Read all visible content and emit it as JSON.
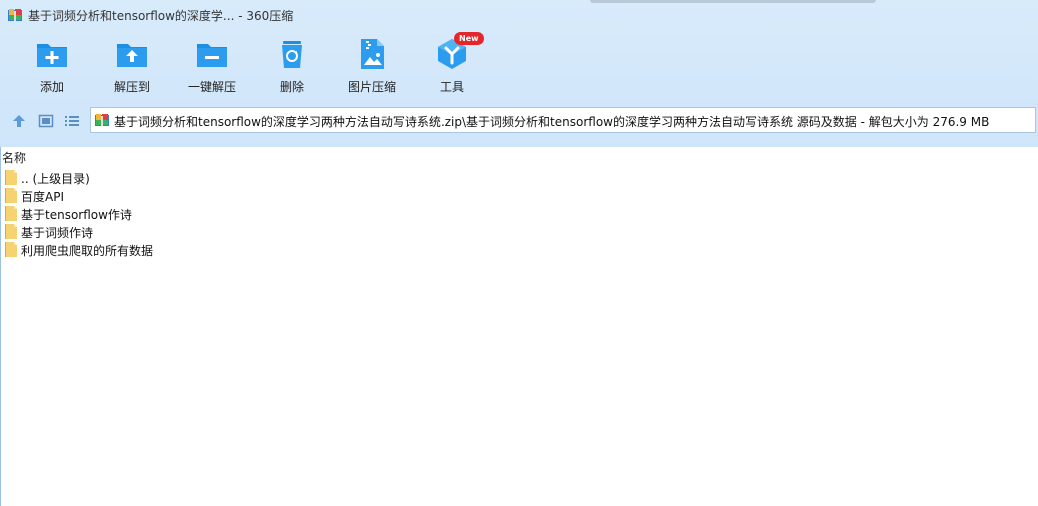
{
  "window": {
    "title": "基于词频分析和tensorflow的深度学... - 360压缩"
  },
  "toolbar": {
    "items": [
      {
        "label": "添加",
        "icon": "add-folder-icon"
      },
      {
        "label": "解压到",
        "icon": "extract-to-icon"
      },
      {
        "label": "一键解压",
        "icon": "one-click-extract-icon"
      },
      {
        "label": "删除",
        "icon": "recycle-bin-icon"
      },
      {
        "label": "图片压缩",
        "icon": "image-compress-icon"
      },
      {
        "label": "工具",
        "icon": "tools-icon",
        "badge": "New"
      }
    ]
  },
  "nav": {
    "up_icon": "up-arrow-icon",
    "view_icon": "thumbnail-view-icon",
    "list_icon": "list-view-icon"
  },
  "address": {
    "path": "基于词频分析和tensorflow的深度学习两种方法自动写诗系统.zip\\基于词频分析和tensorflow的深度学习两种方法自动写诗系统 源码及数据 - 解包大小为 276.9 MB"
  },
  "list": {
    "header_name": "名称",
    "items": [
      {
        "name": ".. (上级目录)"
      },
      {
        "name": "百度API"
      },
      {
        "name": "基于tensorflow作诗"
      },
      {
        "name": "基于词频作诗"
      },
      {
        "name": "利用爬虫爬取的所有数据"
      }
    ]
  },
  "colors": {
    "accent": "#1a8fe3",
    "toolbar_bg": "#d3e7fa",
    "folder": "#f6d271",
    "badge": "#e8242b"
  }
}
